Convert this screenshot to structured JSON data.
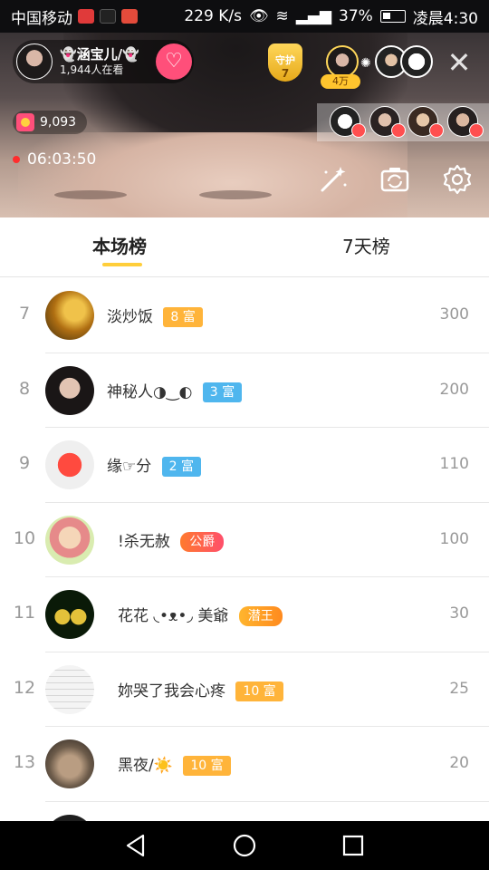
{
  "status_bar": {
    "carrier": "中国移动",
    "network_speed": "229 K/s",
    "battery": "37%",
    "time": "凌晨4:30"
  },
  "live": {
    "host_name": "👻涵宝儿/👻",
    "viewer_count": "1,944人在看",
    "guard_label": "守护",
    "guard_count": "7",
    "top_viewer_badge": "4万",
    "coins": "9,093",
    "elapsed_time": "06:03:50"
  },
  "tabs": {
    "current": "本场榜",
    "seven_day": "7天榜"
  },
  "ranking": [
    {
      "rank": "7",
      "name": "淡炒饭",
      "badge": "8 富",
      "badge_style": "orange",
      "score": "300"
    },
    {
      "rank": "8",
      "name": "神秘人◑‿◐",
      "badge": "3 富",
      "badge_style": "blue",
      "score": "200"
    },
    {
      "rank": "9",
      "name": "缘☞分",
      "badge": "2 富",
      "badge_style": "blue",
      "score": "110"
    },
    {
      "rank": "10",
      "name": "!杀无赦",
      "badge": "公爵",
      "badge_style": "purple",
      "score": "100"
    },
    {
      "rank": "11",
      "name": "花花 ◟•ᴥ•◞ 美爺",
      "badge": "潜王",
      "badge_style": "gold",
      "score": "30"
    },
    {
      "rank": "12",
      "name": "妳哭了我会心疼",
      "badge": "10 富",
      "badge_style": "orange",
      "score": "25"
    },
    {
      "rank": "13",
      "name": "黑夜/☀️",
      "badge": "10 富",
      "badge_style": "orange",
      "score": "20"
    }
  ],
  "colors": {
    "accent_yellow": "#ffce3a",
    "follow_pink": "#ff4f7a",
    "badge_orange": "#ffb43a",
    "badge_blue": "#4fb6ee"
  },
  "icons": {
    "follow": "heart-plus-icon",
    "close": "close-icon",
    "beauty": "magic-wand-icon",
    "camera_flip": "camera-flip-icon",
    "settings": "gear-icon",
    "nav_back": "triangle-back-icon",
    "nav_home": "circle-home-icon",
    "nav_recent": "square-recent-icon"
  }
}
